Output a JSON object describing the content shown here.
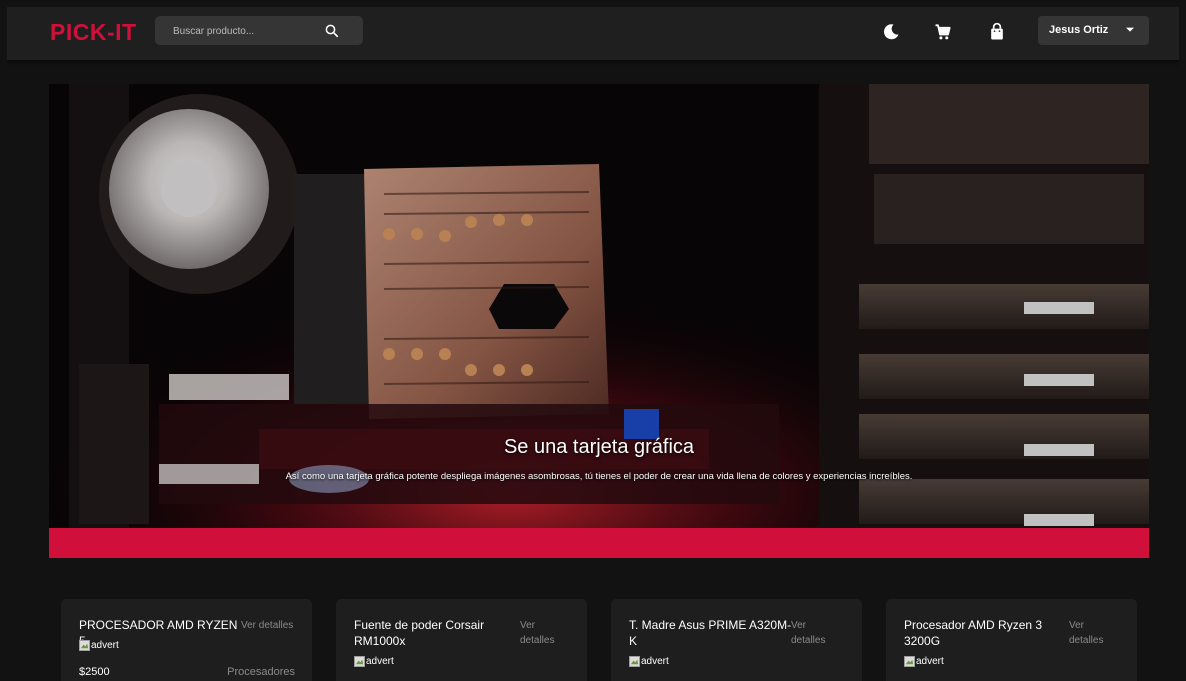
{
  "header": {
    "logo": "PICK-IT",
    "search_placeholder": "Buscar producto...",
    "icons": [
      "moon-icon",
      "cart-icon",
      "shopping-bag-icon",
      "search-icon",
      "chevron-down-icon"
    ],
    "user_name": "Jesus Ortiz"
  },
  "hero": {
    "title": "Se una tarjeta gráfica",
    "description": "Así como una tarjeta gráfica potente despliega imágenes asombrosas, tú tienes el poder de crear una vida llena de colores y experiencias increíbles."
  },
  "products": [
    {
      "name": "PROCESADOR AMD RYZEN 5",
      "details": "Ver detalles",
      "image_alt": "advert",
      "price": "$2500",
      "category": "Procesadores"
    },
    {
      "name": "Fuente de poder Corsair RM1000x",
      "details": "Ver detalles",
      "image_alt": "advert"
    },
    {
      "name": "T. Madre Asus PRIME A320M-K",
      "details": "Ver detalles",
      "image_alt": "advert"
    },
    {
      "name": "Procesador AMD Ryzen 3 3200G",
      "details": "Ver detalles",
      "image_alt": "advert"
    }
  ],
  "colors": {
    "accent": "#d0103a",
    "header_bg": "#1f1f1f",
    "page_bg": "#121212",
    "card_bg": "#1e1e1e",
    "input_bg": "#353535"
  }
}
